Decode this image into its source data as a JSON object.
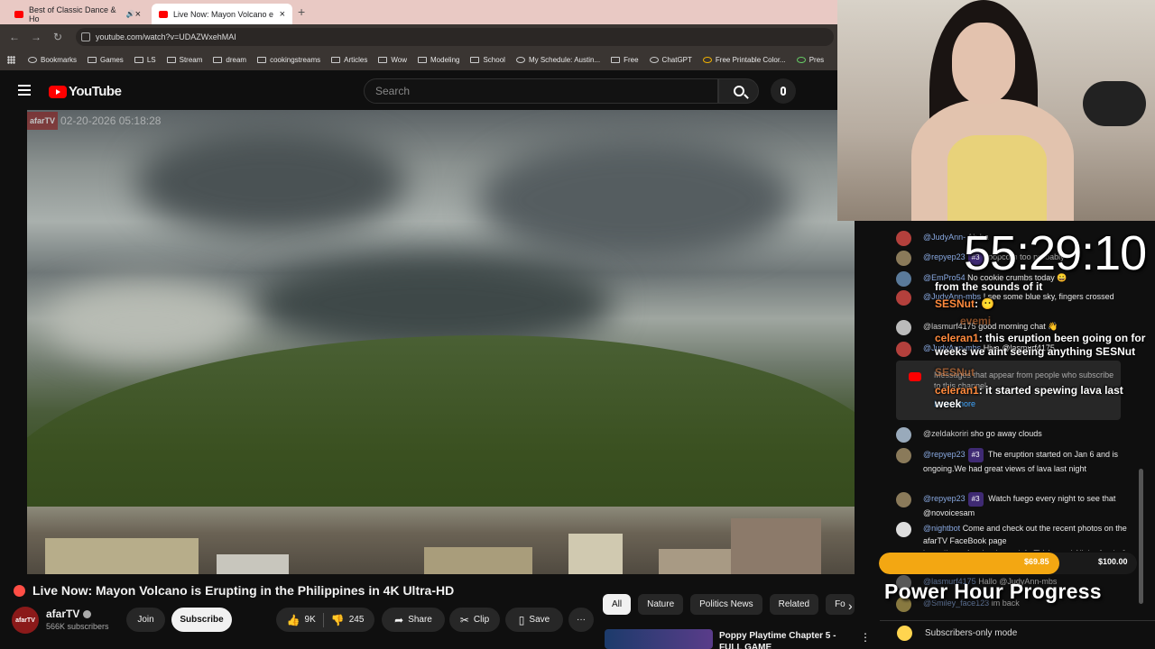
{
  "browser": {
    "tabs": [
      {
        "label": "Best of Classic Dance & Ho"
      },
      {
        "label": "Live Now: Mayon Volcano e"
      }
    ],
    "url": "youtube.com/watch?v=UDAZWxehMAI",
    "bookmarks": [
      "Bookmarks",
      "Games",
      "LS",
      "Stream",
      "dream",
      "cookingstreams",
      "Articles",
      "Wow",
      "Modeling",
      "School",
      "My Schedule: Austin...",
      "Free",
      "ChatGPT",
      "Free Printable Color...",
      "Pres"
    ]
  },
  "youtube": {
    "logo": "YouTube",
    "search_placeholder": "Search",
    "overlay": {
      "brand": "afarTV",
      "timestamp": "02-20-2026 05:18:28"
    },
    "video_title": "Live Now: Mayon Volcano is Erupting in the Philippines in 4K Ultra-HD",
    "channel": {
      "name": "afarTV",
      "avatar": "afarTV",
      "subscribers": "566K subscribers"
    },
    "buttons": {
      "join": "Join",
      "subscribe": "Subscribe",
      "likes": "9K",
      "dislikes": "245",
      "share": "Share",
      "clip": "Clip",
      "save": "Save",
      "more": "···"
    },
    "chips": [
      "All",
      "Nature",
      "Politics News",
      "Related",
      "Fo"
    ],
    "recommendation": {
      "title": "Poppy Playtime Chapter 5 - FULL GAME"
    }
  },
  "chat": {
    "messages": [
      {
        "name": "@JudyAnn-",
        "text": "Ah ha"
      },
      {
        "name": "@repyep23",
        "badge": "#3",
        "text": "popcorn too probably"
      },
      {
        "name": "@EmPro54",
        "text": "No cookie crumbs today 😀"
      },
      {
        "name": "@JudyAnn-mbs",
        "text": "I see some blue sky, fingers crossed"
      },
      {
        "name": "@lasmurf4175",
        "text": "good morning chat 👋"
      },
      {
        "name": "@JudyAnn-mbs",
        "text": "Hiya @lasmurf4175"
      },
      {
        "name": "@zeldakoriri",
        "text": "sho go away clouds"
      },
      {
        "name": "@repyep23",
        "badge": "#3",
        "text": "The eruption started on Jan 6 and is ongoing.We had great views of lava last night"
      },
      {
        "name": "@repyep23",
        "badge": "#3",
        "text": "Watch fuego every night to see that @novoicesam"
      },
      {
        "name": "@nightbot",
        "text": "Come and check out the recent photos on the afarTV FaceBook page https://www.facebook.com/afarTVchannel All the feeds & Videos"
      },
      {
        "name": "@lasmurf4175",
        "text": "Hallo @JudyAnn-mbs"
      },
      {
        "name": "@Smiley_face123",
        "text": "im back"
      }
    ],
    "members_notice": {
      "text": "Messages that appear from people who subscribe to this channel",
      "link": "Learn more"
    },
    "subscribers_only": "Subscribers-only mode"
  },
  "stream_overlay": {
    "timer": "55:29:10",
    "lines": [
      {
        "user": "",
        "text": "from the sounds of it"
      },
      {
        "user": "SESNut",
        "text": "😶"
      },
      {
        "user": "evemi",
        "text": ""
      },
      {
        "user": "celeran1",
        "text": "this eruption been going on for weeks we aint seeing anything SESNut"
      },
      {
        "user": "SESNut",
        "text": ""
      },
      {
        "user": "celeran1",
        "text": "it started spewing lava last week"
      }
    ],
    "progress": {
      "current": "$69.85",
      "goal": "$100.00",
      "fraction": 0.6985,
      "title": "Power Hour Progress",
      "color": "#f3a712"
    }
  }
}
